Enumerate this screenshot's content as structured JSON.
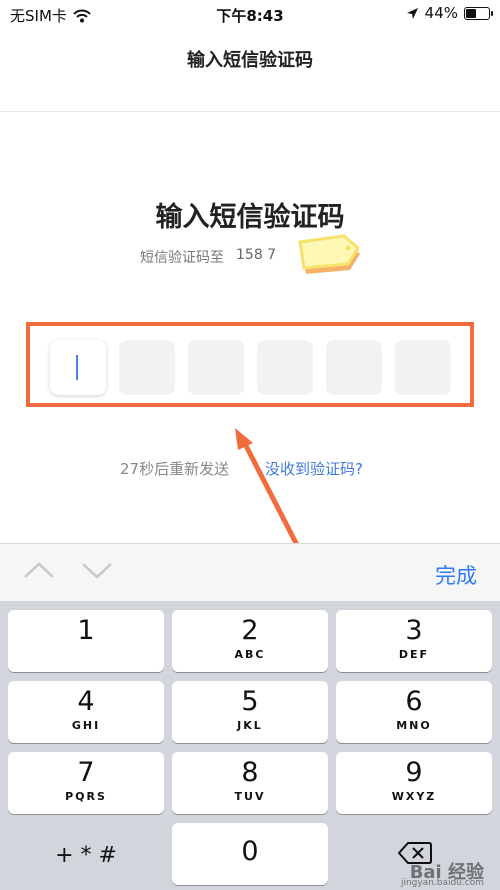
{
  "status_bar": {
    "carrier": "无SIM卡",
    "time": "下午8:43",
    "battery_percent": "44%",
    "battery_level": 0.44,
    "icons": [
      "wifi-icon",
      "location-arrow-icon",
      "battery-icon"
    ]
  },
  "nav": {
    "title": "输入短信验证码"
  },
  "main": {
    "heading": "输入短信验证码",
    "sms_prefix": "短信验证码至",
    "phone_partial": "158 7",
    "code_boxes": 6,
    "active_box": 0,
    "resend_text": "27秒后重新发送",
    "no_code_link": "没收到验证码?"
  },
  "toolbar": {
    "prev_icon": "chevron-up-icon",
    "next_icon": "chevron-down-icon",
    "done_label": "完成"
  },
  "keyboard": {
    "keys": [
      {
        "digit": "1",
        "letters": ""
      },
      {
        "digit": "2",
        "letters": "ABC"
      },
      {
        "digit": "3",
        "letters": "DEF"
      },
      {
        "digit": "4",
        "letters": "GHI"
      },
      {
        "digit": "5",
        "letters": "JKL"
      },
      {
        "digit": "6",
        "letters": "MNO"
      },
      {
        "digit": "7",
        "letters": "PQRS"
      },
      {
        "digit": "8",
        "letters": "TUV"
      },
      {
        "digit": "9",
        "letters": "WXYZ"
      },
      {
        "digit": "+ * #",
        "letters": ""
      },
      {
        "digit": "0",
        "letters": ""
      }
    ],
    "delete_icon": "backspace-icon"
  },
  "watermark": {
    "text": "Bai 经验",
    "sub": "jingyan.baidu.com"
  },
  "colors": {
    "accent_blue": "#2f7bf6",
    "link_blue": "#3f7ad8",
    "annotation_orange": "#f26b3c",
    "keyboard_bg": "#d2d5db"
  }
}
